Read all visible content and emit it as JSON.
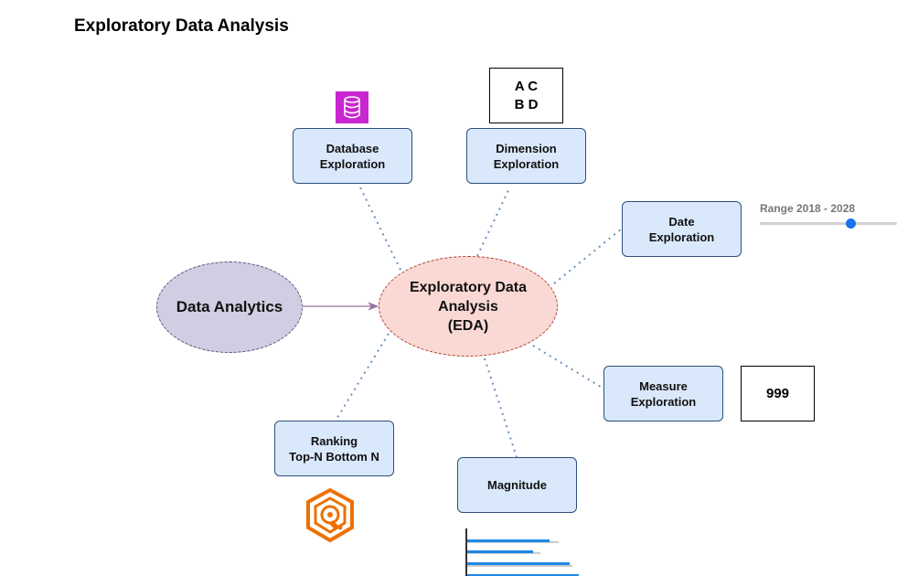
{
  "title": "Exploratory Data Analysis",
  "nodes": {
    "data_analytics": "Data Analytics",
    "eda": "Exploratory Data\nAnalysis\n(EDA)",
    "database": "Database\nExploration",
    "dimension": "Dimension\nExploration",
    "date": "Date\nExploration",
    "measure": "Measure\nExploration",
    "ranking": "Ranking\nTop-N Bottom N",
    "magnitude": "Magnitude"
  },
  "dimension_sample": "A C\nB D",
  "measure_sample": "999",
  "range": {
    "label": "Range 2018 - 2028",
    "min": 2018,
    "max": 2028,
    "value": 2024.6
  },
  "icons": {
    "database": "database-icon",
    "ranking": "hexagon-target-icon",
    "magnitude": "bar-chart-icon"
  },
  "colors": {
    "node_fill": "#dae8fc",
    "node_border": "#2c4f7c",
    "eda_fill": "#fad9d5",
    "eda_border": "#ae4132",
    "analytics_fill": "#d0cee2",
    "analytics_border": "#56517e",
    "connector": "#6c8ebf",
    "arrow": "#9673a6",
    "db_icon": "#c925d1",
    "rank_icon": "#ed7100",
    "slider": "#1a73e8",
    "bar": "#1e88e5"
  }
}
